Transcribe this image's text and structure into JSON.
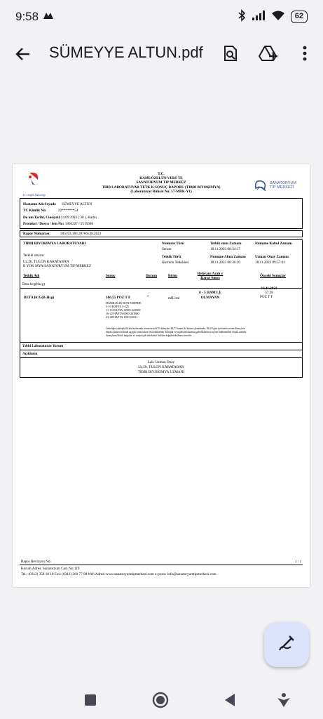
{
  "status_bar": {
    "time": "9:58",
    "battery": "62"
  },
  "app_bar": {
    "title": "SÜMEYYE ALTUN.pdf"
  },
  "report": {
    "logo_text": "T.C. Sağlık Bakanlığı",
    "hospital_logo_text": "SANATORYUM TIP MERKEZİ",
    "header_line1": "T.C.",
    "header_line2": "KAMUÖZELÜN VERS TE",
    "header_line3": "SANATORYUM TIP MERKEZ",
    "header_line4": "TIBB LABORATUVAR TETK K SONUÇ RAPORU (TIBBI BIYOKIMYA)",
    "header_line5": "(Laboratuvar Ruhsat No: 57-MRK-Y1)",
    "patient_name_label": "Hastanın Adı Soyadı:",
    "patient_name": "SÜMEYYE ALTUN",
    "tc_label": "TC Kimlik No:",
    "tc_value": "32*******54",
    "dob_label": "Do um Tarihi, Cinsiyeti:",
    "dob_value": ": 24.09.1993 ( 30 ), Kadın",
    "protocol_label": "Protokol / Dosya /     lem No:",
    "protocol_value": ": 1866227 / 2515680",
    "report_no_label": "Rapor Numarası:",
    "report_no_value": "505193.186.20766538.2023",
    "lab_name": "TIBBI BIYOKIMYA LABORATUVARI",
    "requester_label": "Tetkiki  steyen:",
    "requester": "Uz.Dr. TULON KARATABAN",
    "requester_dept": "B YOK MYA/SANATORYUM TIP MERKEZ",
    "sample_type_label": "Numune Türü",
    "sample_type": "Serum",
    "test_type_label": "Tetkik Türü",
    "test_type": "Hormon Tetkikleri",
    "request_time_label": "Tetkik  stem Zamanı",
    "request_time": "18.11.2023 08:34:17",
    "sample_time_label": "Numune Alma Zamanı",
    "sample_time": "18.11.2023 08:36:10",
    "accept_time_label": "Numune Kabul Zamanı",
    "approve_time_label": "Uzman Onay Zamanı",
    "approve_time": "18.11.2023 09:57:01",
    "col_test": "Tetkik Adı",
    "col_result": "Sonuç",
    "col_status": "Durum",
    "col_unit": "Birim",
    "col_ref_1": "Referans Aralı ı/",
    "col_ref_2": "Karar Sınırı",
    "col_prev": "Önceki Sonuçlar",
    "group_name": "Beta hcg(bhcg)",
    "prev_date": "16.11.2023",
    "prev_time": "57:28",
    "prev_value": "POZ T F",
    "test_name": "BETA hCG(B-Hcg)",
    "test_result": "166.55 POZ  T  F",
    "test_flag": "*",
    "test_unit": "mIU/ml",
    "ref_1": "0 - 5 HAM LE",
    "ref_2": "OLMAYAN",
    "pregnancy_title": "HAMILELIK DÖN EMINDE",
    "pregnancy_rows": [
      "3-10    HAFTA      5-225",
      "11-15   HAFTA      16985-223800",
      "16-22   HAFTA      6900-223800",
      "23-40   HAFTA      1500-63011"
    ],
    "note_lines": [
      "Gebeliğin yaklaşık ilk altı haftasında serum beta-hCG düzeyleri 48-72 saatte iki katına çıkmaktadır. İlk 10 gün içerisinde serum düzeyinin",
      "düşük çıkması halinde ug gün sonra tekrar test edilmelidir. Ektopik veya gelişimi durmuş gebeliklerde artış hızı beklenenden düşük olabilir.",
      "Sonuçların klinik bulgular ve radyolojik tetkiklerle birlikte değerlendirilmesi önerilir."
    ],
    "comment_label": "Tıbbi Laboratuvar Yorum",
    "explanation_label": "Açıklama",
    "approval_1": "Lab. Uzman Onay",
    "approval_2": "Uz.Dr. TULON KARATABAN",
    "approval_3": "TIBBI BIYOKIMYA UZMANI",
    "footer_revision": "Rapor Revizyon No:",
    "footer_page": "1 / 1",
    "footer_address": "Kurum Adres: Sanatoryum Cad. No:119",
    "footer_contact": "Tel.: (0312) 358 10 10      Fax: (0312) 360 77 00      Web Adresi:www.sanatoryumtipmerkezi.com          e-posta: info@sanatoryumtipmerkezi.com"
  },
  "colors": {
    "background": "#f2f1f4",
    "fab": "#dde3fb",
    "logo_red": "#d52b2b",
    "logo_blue": "#3a4f9a"
  }
}
